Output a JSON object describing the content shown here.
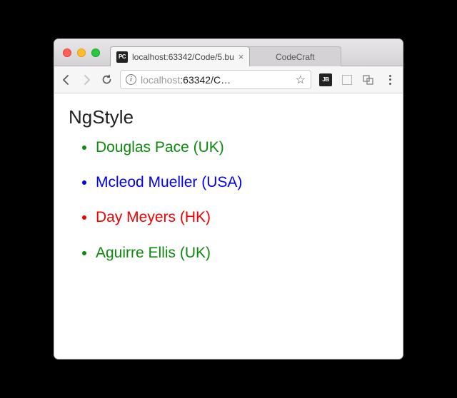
{
  "window": {
    "tabs": [
      {
        "favicon": "PC",
        "title": "localhost:63342/Code/5.bu",
        "active": true
      },
      {
        "title": "CodeCraft",
        "active": false
      }
    ]
  },
  "toolbar": {
    "url_prefix": "localhost",
    "url_rest": ":63342/C…",
    "extension_badge": "JB"
  },
  "content": {
    "heading": "NgStyle",
    "people": [
      {
        "label": "Douglas Pace (UK)",
        "colorClass": "c-green"
      },
      {
        "label": "Mcleod Mueller (USA)",
        "colorClass": "c-blue"
      },
      {
        "label": "Day Meyers (HK)",
        "colorClass": "c-red"
      },
      {
        "label": "Aguirre Ellis (UK)",
        "colorClass": "c-green"
      }
    ]
  }
}
